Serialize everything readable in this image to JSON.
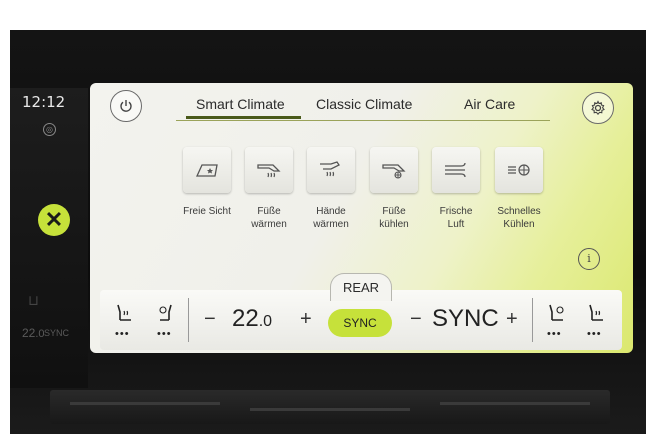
{
  "side": {
    "time": "12:12",
    "temp": "22",
    "temp_dec": ".0",
    "sync": "SYNC"
  },
  "tabs": [
    {
      "label": "Smart Climate",
      "active": true
    },
    {
      "label": "Classic Climate",
      "active": false
    },
    {
      "label": "Air Care",
      "active": false
    }
  ],
  "functions": [
    {
      "line1": "Freie Sicht",
      "line2": "",
      "icon": "windshield-defrost-icon"
    },
    {
      "line1": "Füße",
      "line2": "wärmen",
      "icon": "feet-warm-icon"
    },
    {
      "line1": "Hände",
      "line2": "wärmen",
      "icon": "hands-warm-icon"
    },
    {
      "line1": "Füße",
      "line2": "kühlen",
      "icon": "feet-cool-icon"
    },
    {
      "line1": "Frische",
      "line2": "Luft",
      "icon": "fresh-air-icon"
    },
    {
      "line1": "Schnelles",
      "line2": "Kühlen",
      "icon": "fast-cool-icon"
    }
  ],
  "bottom": {
    "rear_label": "REAR",
    "minus": "−",
    "plus": "+",
    "temp_main": "22",
    "temp_dec": ".0",
    "sync_button": "SYNC",
    "sync_text": "SYNC"
  },
  "colors": {
    "accent": "#c6e13a",
    "screen_bg": "#f0f0ea"
  }
}
